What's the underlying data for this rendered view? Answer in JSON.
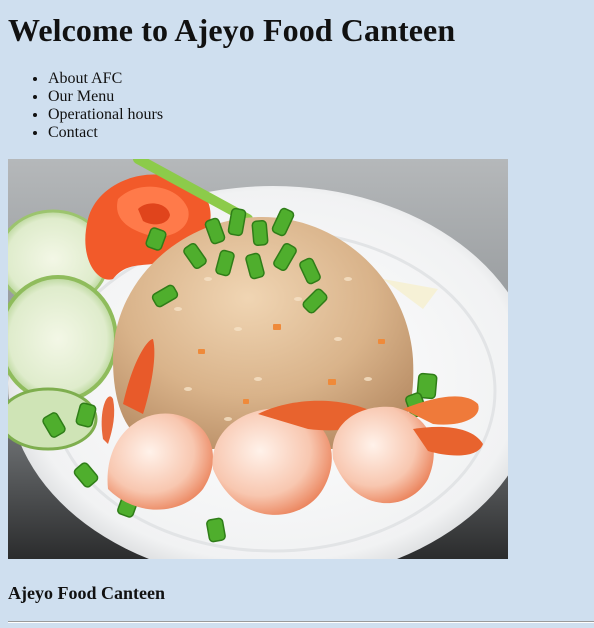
{
  "page": {
    "title": "Welcome to Ajeyo Food Canteen",
    "footer_heading": "Ajeyo Food Canteen",
    "background_color": "#cfdfef"
  },
  "nav": {
    "items": [
      {
        "label": "About AFC"
      },
      {
        "label": "Our Menu"
      },
      {
        "label": "Operational hours"
      },
      {
        "label": "Contact"
      }
    ]
  },
  "hero": {
    "image": "fried-rice-with-shrimp-photo"
  }
}
